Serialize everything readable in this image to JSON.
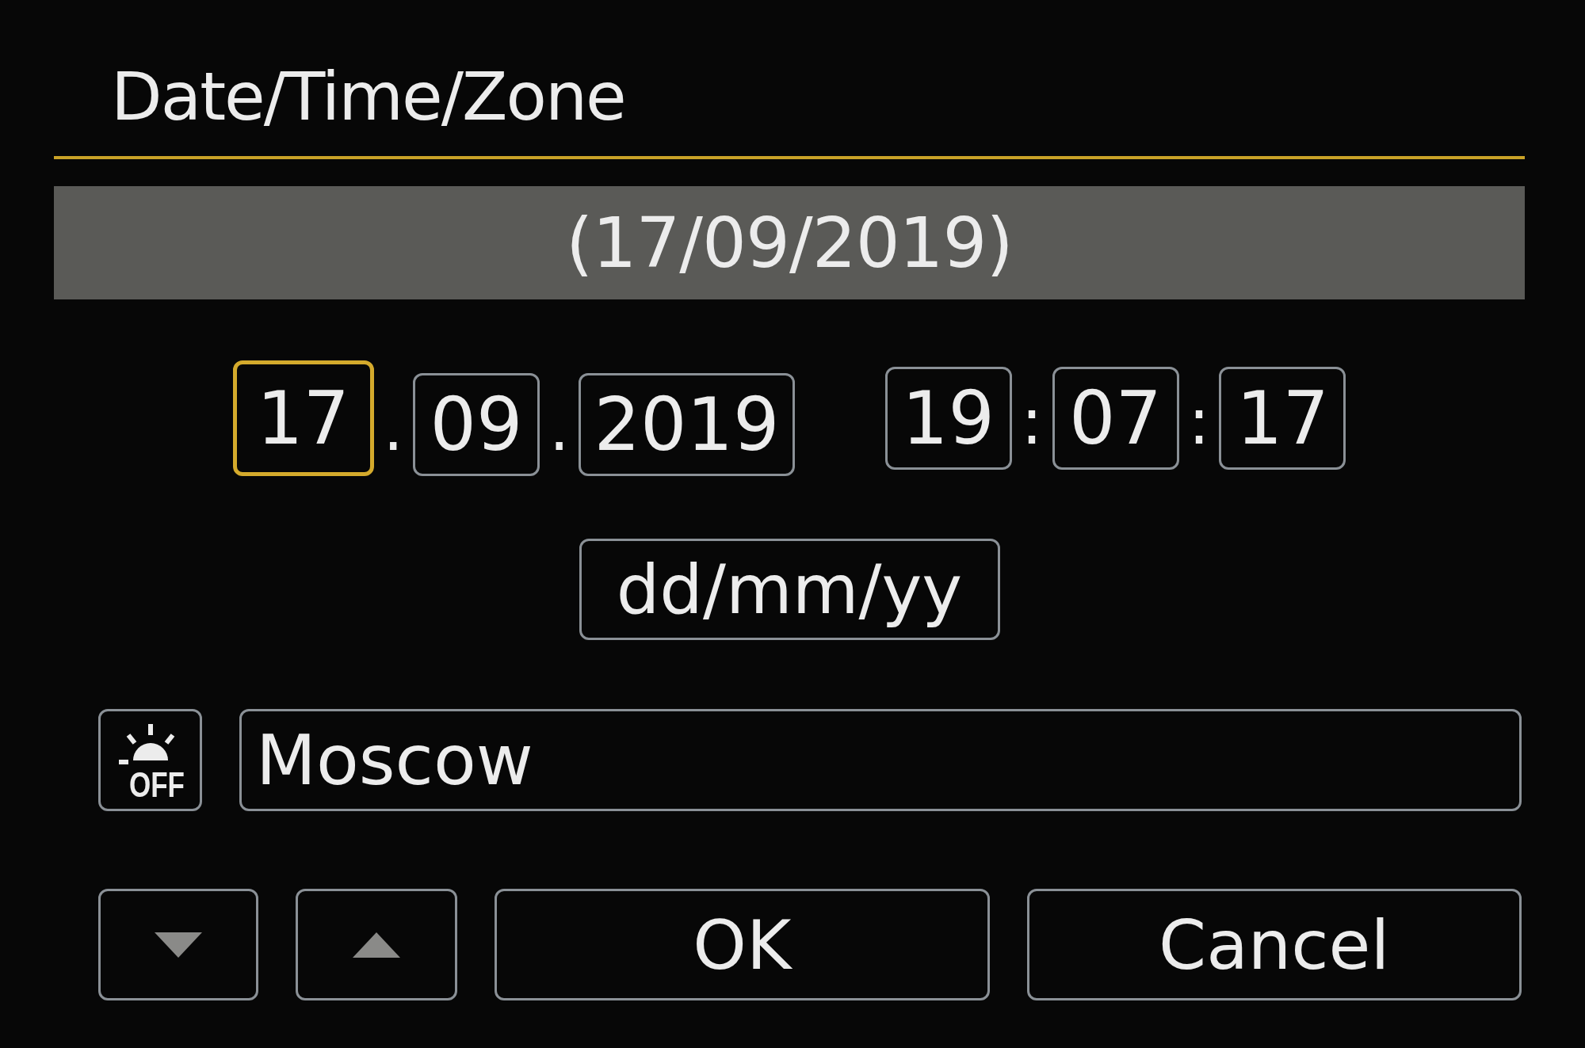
{
  "title": "Date/Time/Zone",
  "summary": "(17/09/2019)",
  "groups": [
    [
      {
        "kind": "field",
        "value": "17",
        "selected": true
      },
      {
        "kind": "separator",
        "text": "."
      },
      {
        "kind": "field",
        "value": "09",
        "selected": false
      },
      {
        "kind": "separator",
        "text": "."
      },
      {
        "kind": "field",
        "value": "2019",
        "selected": false
      }
    ],
    [
      {
        "kind": "field",
        "value": "19",
        "selected": false
      },
      {
        "kind": "separator",
        "text": ":"
      },
      {
        "kind": "field",
        "value": "07",
        "selected": false
      },
      {
        "kind": "separator",
        "text": ":"
      },
      {
        "kind": "field",
        "value": "17",
        "selected": false
      }
    ]
  ],
  "date_format": "dd/mm/yy",
  "dst": {
    "on": false,
    "label": "OFF"
  },
  "zone": "Moscow",
  "buttons": [
    {
      "kind": "down"
    },
    {
      "kind": "up"
    },
    {
      "kind": "text",
      "label": "OK"
    },
    {
      "kind": "text",
      "label": "Cancel"
    }
  ]
}
